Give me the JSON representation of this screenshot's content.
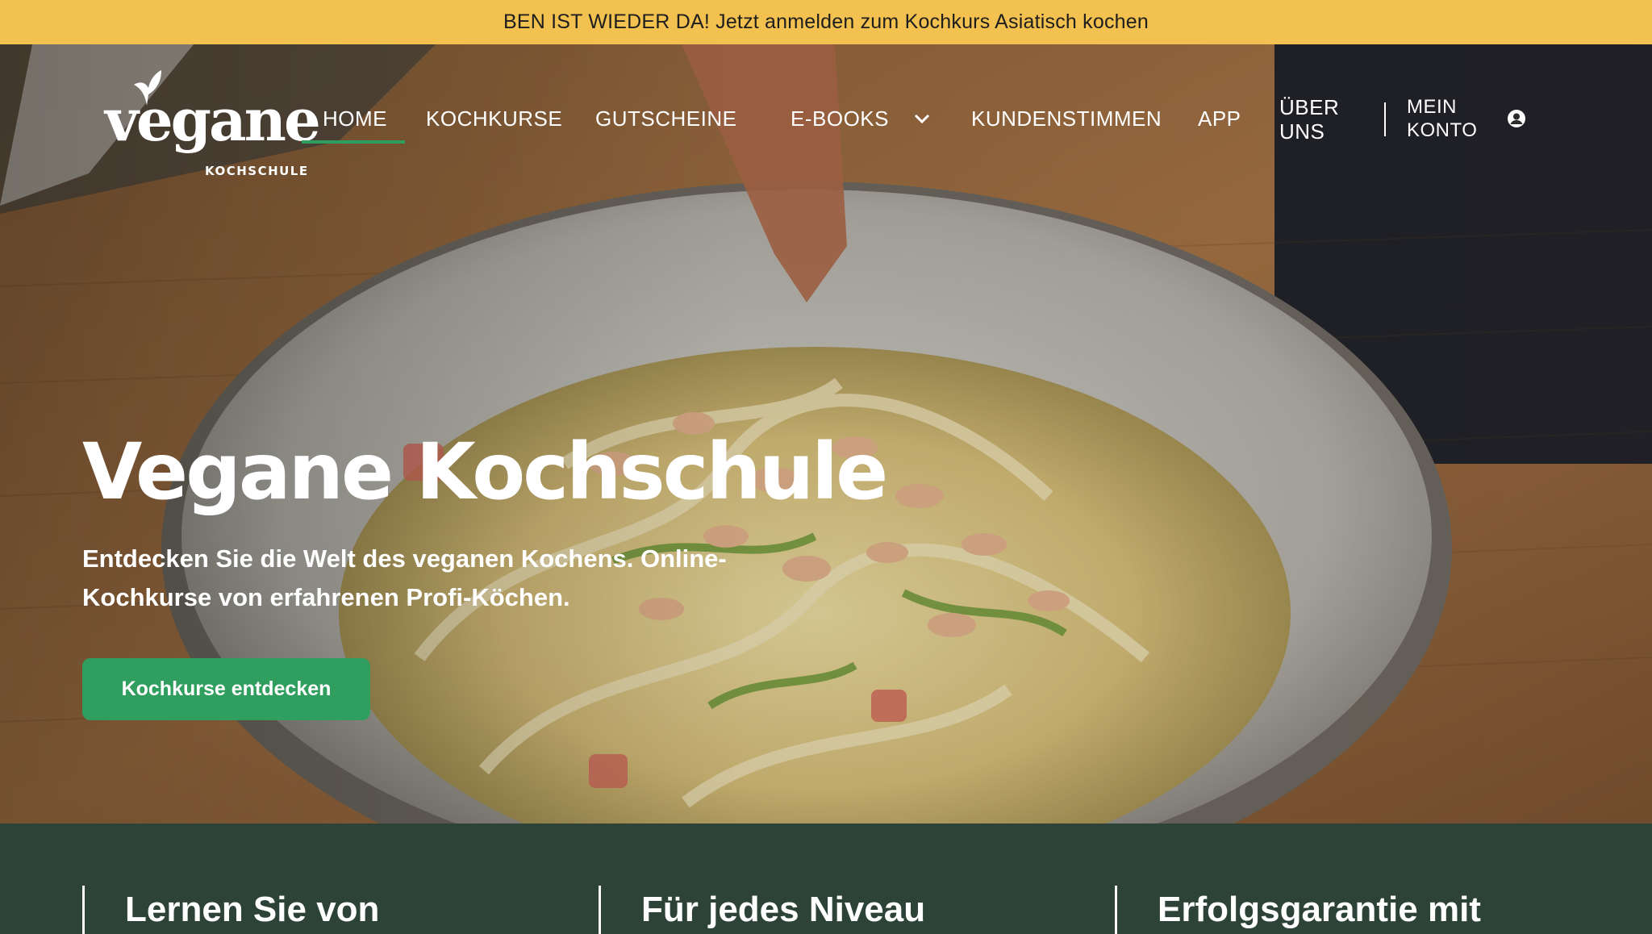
{
  "announcement": {
    "text": "BEN IST WIEDER DA! Jetzt anmelden zum Kochkurs Asiatisch kochen"
  },
  "brand": {
    "name": "vegane",
    "subtitle": "KOCHSCHULE"
  },
  "nav": {
    "items": [
      {
        "label": "HOME",
        "active": true
      },
      {
        "label": "KOCHKURSE"
      },
      {
        "label": "GUTSCHEINE"
      },
      {
        "label": "E-BOOKS",
        "icon": "chevron-down-icon"
      },
      {
        "label": "KUNDENSTIMMEN"
      },
      {
        "label": "APP"
      },
      {
        "label": "ÜBER UNS"
      }
    ],
    "account": {
      "label": "MEIN KONTO",
      "icon": "user-circle-icon"
    }
  },
  "hero": {
    "title": "Vegane Kochschule",
    "subtitle": "Entdecken Sie die Welt des veganen Kochens. Online-Kochkurse von erfahrenen Profi-Köchen.",
    "cta_label": "Kochkurse entdecken"
  },
  "features": [
    {
      "title": "Lernen Sie von"
    },
    {
      "title": "Für jedes Niveau"
    },
    {
      "title": "Erfolgsgarantie mit"
    }
  ],
  "colors": {
    "announcement_bg": "#f2c14f",
    "accent_green": "#2f9e5f",
    "section_bg": "#2e4338"
  }
}
